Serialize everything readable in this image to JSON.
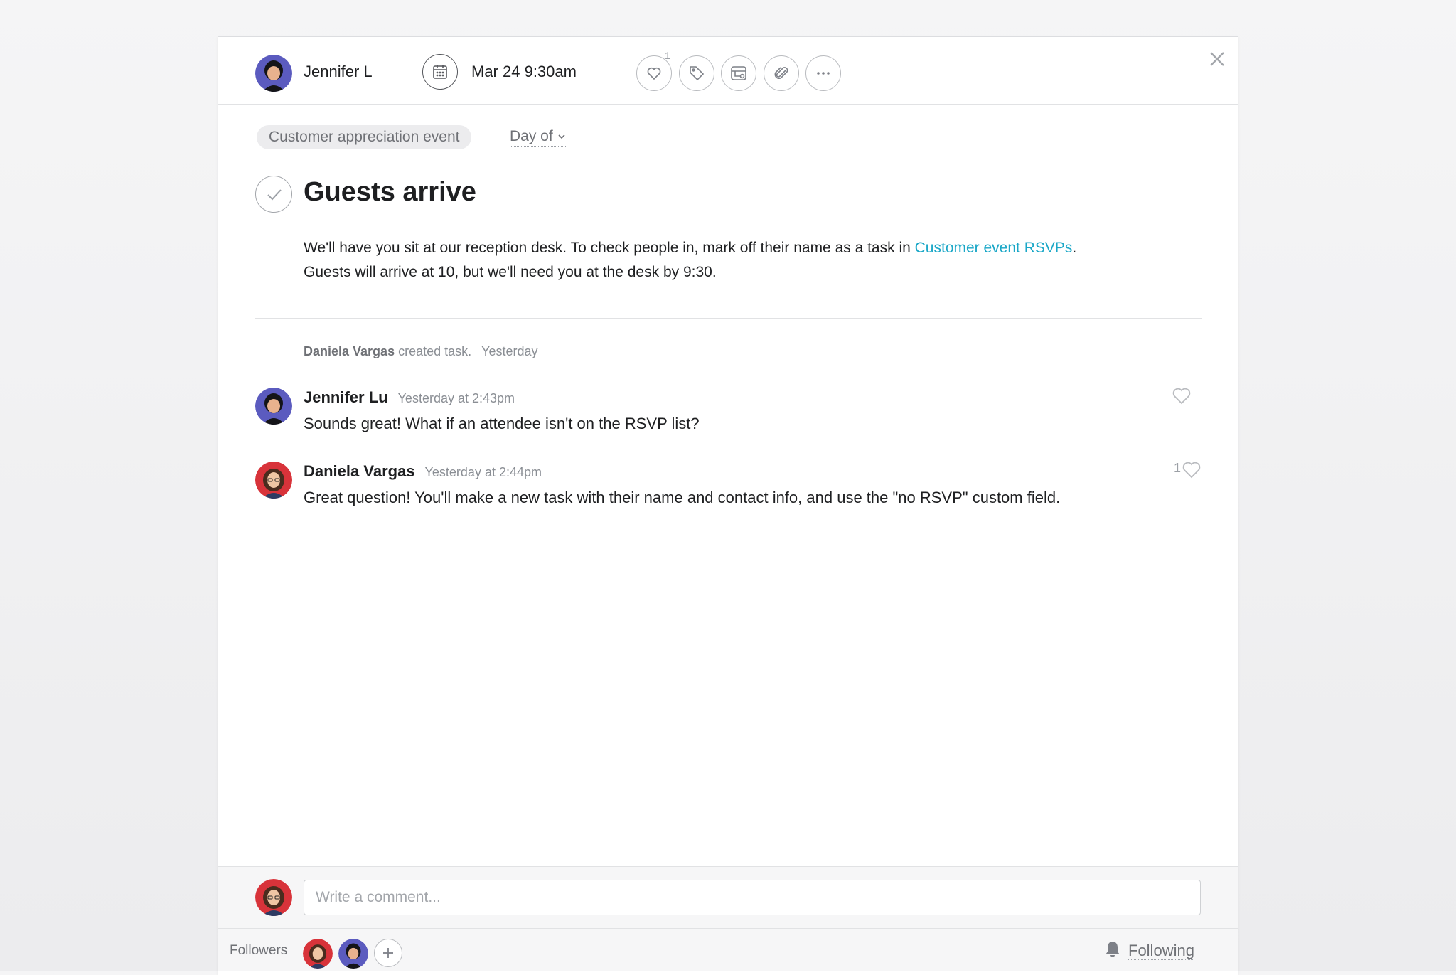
{
  "toolbar": {
    "assignee_name": "Jennifer L",
    "due_date": "Mar 24 9:30am",
    "like_count": "1",
    "icons": [
      "calendar-icon",
      "heart-icon",
      "tag-icon",
      "subtask-icon",
      "attachment-icon",
      "more-icon",
      "close-icon"
    ]
  },
  "task": {
    "project": "Customer appreciation event",
    "section": "Day of",
    "title": "Guests arrive",
    "description_pre": "We'll have you sit at our reception desk. To check people in, mark off their name as a task in ",
    "description_link": "Customer event RSVPs",
    "description_post": ".",
    "description_line2": "Guests will arrive at 10, but we'll need you at the desk by 9:30."
  },
  "activity": {
    "story_author": "Daniela Vargas",
    "story_action": " created task.",
    "story_time": "Yesterday",
    "comments": [
      {
        "author": "Jennifer Lu",
        "time": "Yesterday at 2:43pm",
        "text": "Sounds great! What if an attendee isn't on the RSVP list?",
        "likes": ""
      },
      {
        "author": "Daniela Vargas",
        "time": "Yesterday at 2:44pm",
        "text": "Great question! You'll make a new task with their name and contact info, and use the \"no RSVP\" custom field.",
        "likes": "1"
      }
    ]
  },
  "footer": {
    "comment_placeholder": "Write a comment...",
    "followers_label": "Followers",
    "following_label": "Following"
  },
  "colors": {
    "link": "#1aa7c7",
    "avatar_jennifer_bg": "#5b5bbf",
    "avatar_daniela_bg": "#d8333a"
  }
}
